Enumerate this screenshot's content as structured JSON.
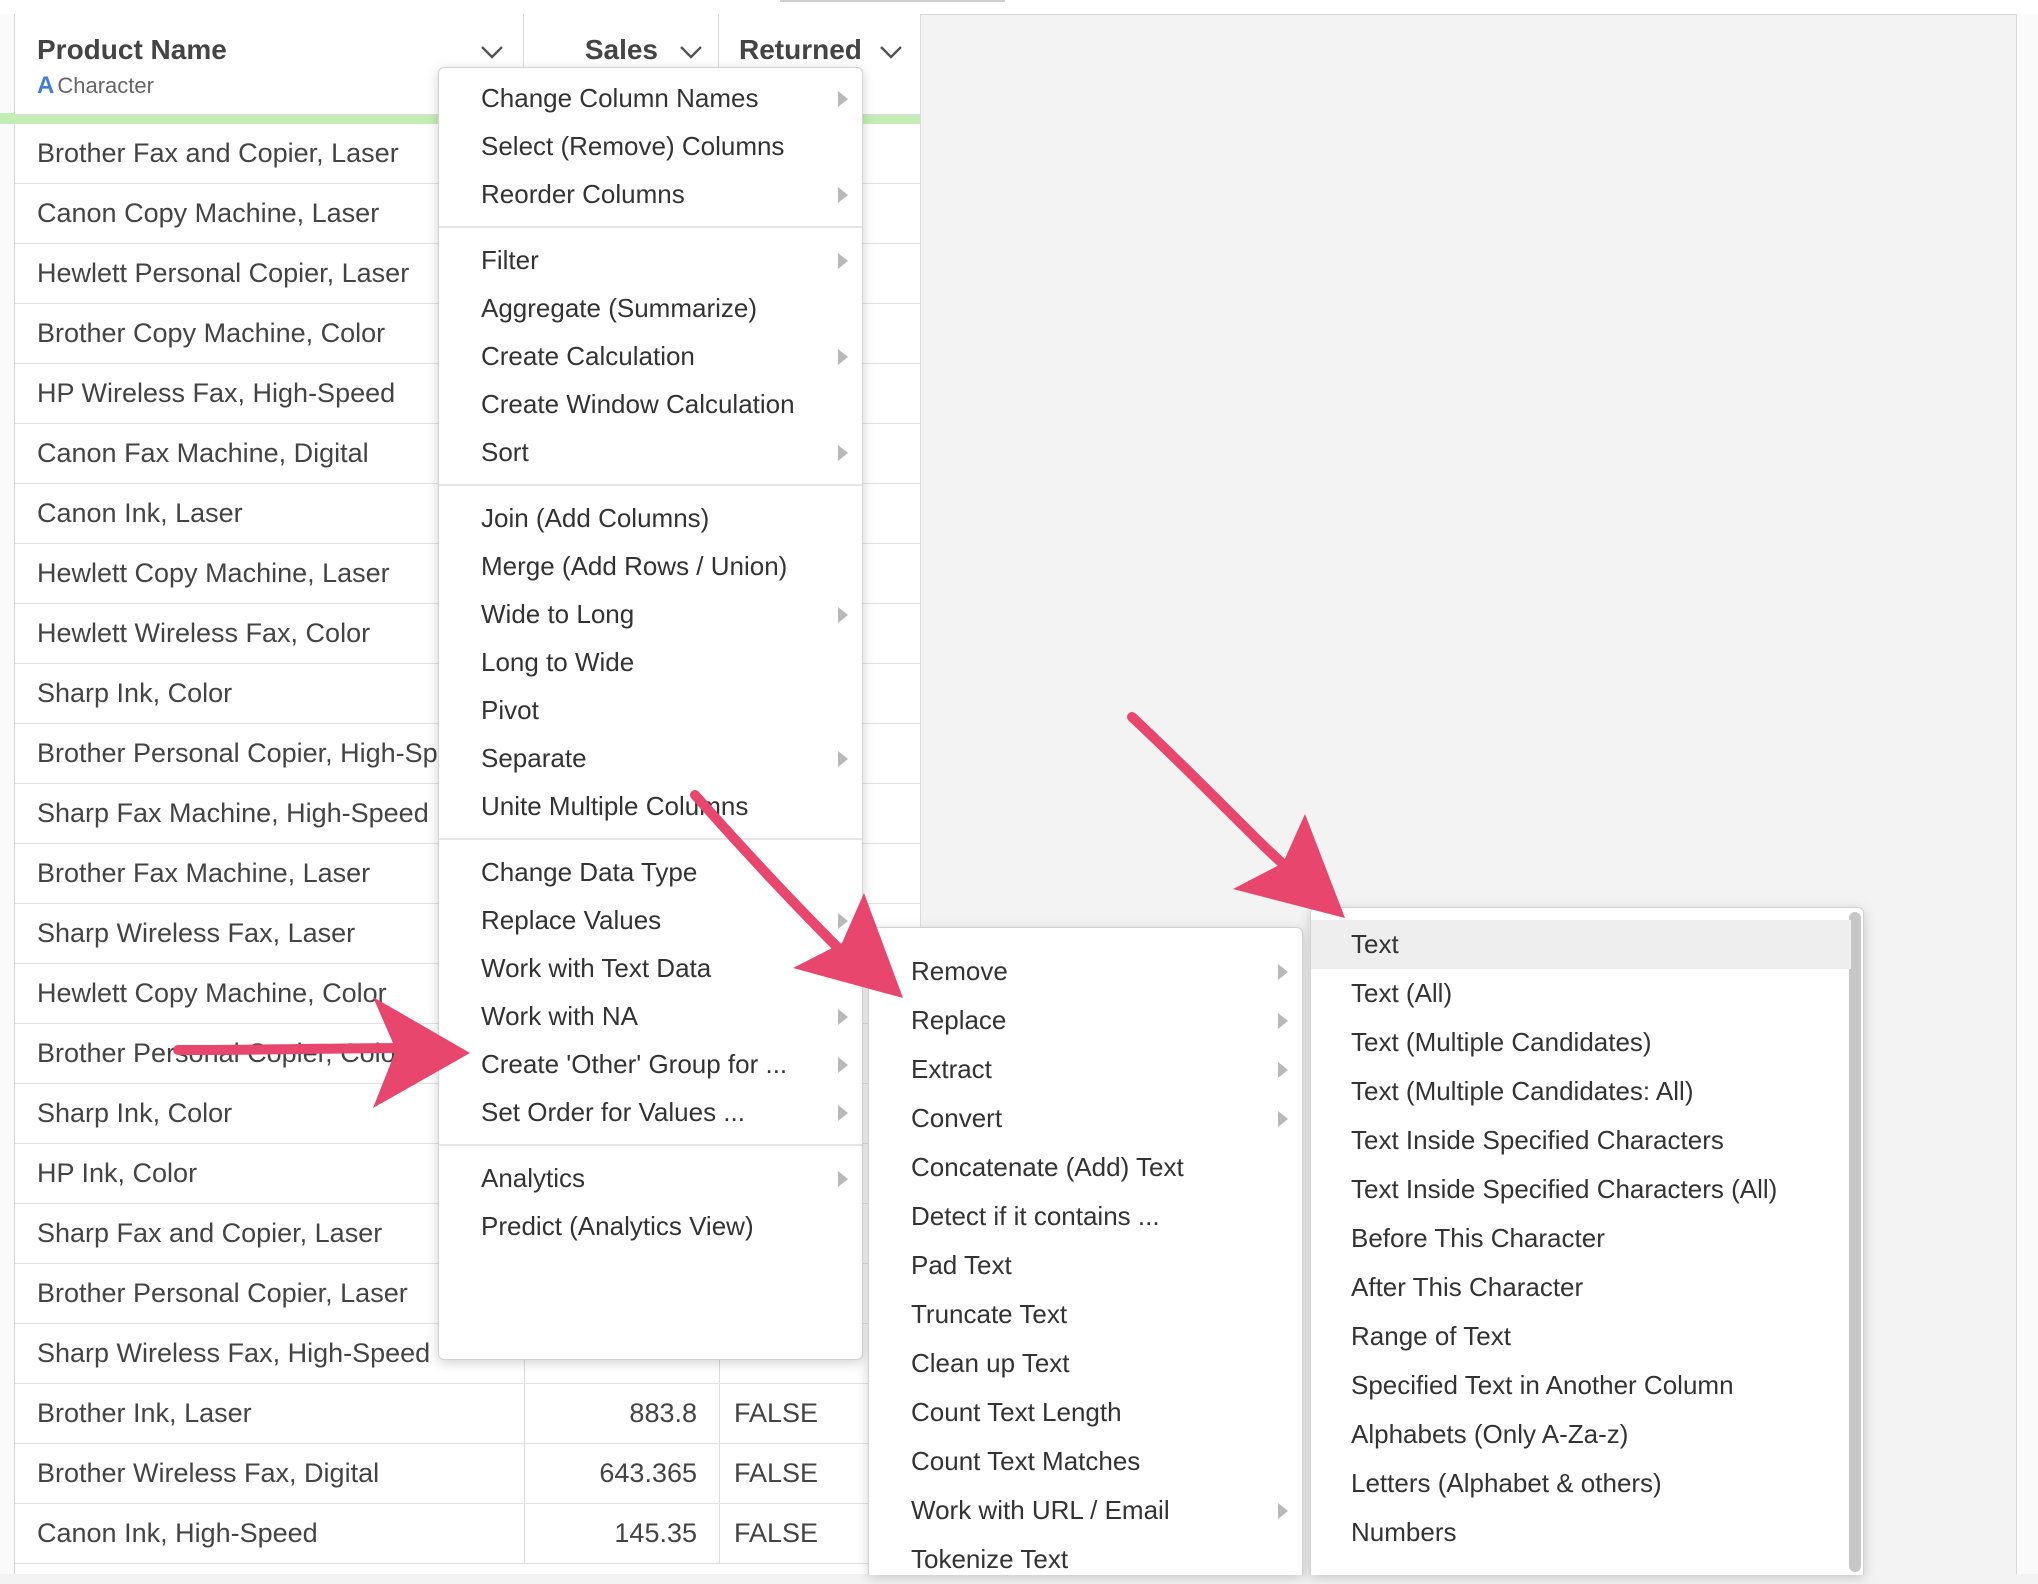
{
  "colors": {
    "accent_green": "#c2eeb6",
    "type_icon_blue": "#3d7fd9",
    "arrow": "#e8466c"
  },
  "table": {
    "columns": [
      {
        "name": "Product Name",
        "type_icon": "A",
        "type": "Character"
      },
      {
        "name": "Sales"
      },
      {
        "name": "Returned"
      }
    ],
    "rows": [
      [
        "Brother Fax and Copier, Laser",
        "",
        ""
      ],
      [
        "Canon Copy Machine, Laser",
        "",
        ""
      ],
      [
        "Hewlett Personal Copier, Laser",
        "",
        ""
      ],
      [
        "Brother Copy Machine, Color",
        "",
        ""
      ],
      [
        "HP Wireless Fax, High-Speed",
        "",
        ""
      ],
      [
        "Canon Fax Machine, Digital",
        "",
        ""
      ],
      [
        "Canon Ink, Laser",
        "",
        ""
      ],
      [
        "Hewlett Copy Machine, Laser",
        "",
        ""
      ],
      [
        "Hewlett Wireless Fax, Color",
        "",
        ""
      ],
      [
        "Sharp Ink, Color",
        "",
        ""
      ],
      [
        "Brother Personal Copier, High-Speed",
        "",
        ""
      ],
      [
        "Sharp Fax Machine, High-Speed",
        "",
        ""
      ],
      [
        "Brother Fax Machine, Laser",
        "",
        ""
      ],
      [
        "Sharp Wireless Fax, Laser",
        "",
        ""
      ],
      [
        "Hewlett Copy Machine, Color",
        "",
        ""
      ],
      [
        "Brother Personal Copier, Color",
        "",
        ""
      ],
      [
        "Sharp Ink, Color",
        "",
        ""
      ],
      [
        "HP Ink, Color",
        "",
        ""
      ],
      [
        "Sharp Fax and Copier, Laser",
        "",
        ""
      ],
      [
        "Brother Personal Copier, Laser",
        "",
        ""
      ],
      [
        "Sharp Wireless Fax, High-Speed",
        "",
        ""
      ],
      [
        "Brother Ink, Laser",
        "883.8",
        "FALSE"
      ],
      [
        "Brother Wireless Fax, Digital",
        "643.365",
        "FALSE"
      ],
      [
        "Canon Ink, High-Speed",
        "145.35",
        "FALSE"
      ]
    ]
  },
  "column_menu": {
    "groups": [
      [
        {
          "label": "Change Column Names",
          "submenu": true
        },
        {
          "label": "Select (Remove) Columns",
          "submenu": false
        },
        {
          "label": "Reorder Columns",
          "submenu": true
        }
      ],
      [
        {
          "label": "Filter",
          "submenu": true
        },
        {
          "label": "Aggregate (Summarize)",
          "submenu": false
        },
        {
          "label": "Create Calculation",
          "submenu": true
        },
        {
          "label": "Create Window Calculation",
          "submenu": false
        },
        {
          "label": "Sort",
          "submenu": true
        }
      ],
      [
        {
          "label": "Join (Add Columns)",
          "submenu": false
        },
        {
          "label": "Merge (Add Rows / Union)",
          "submenu": false
        },
        {
          "label": "Wide to Long",
          "submenu": true
        },
        {
          "label": "Long to Wide",
          "submenu": false
        },
        {
          "label": "Pivot",
          "submenu": false
        },
        {
          "label": "Separate",
          "submenu": true
        },
        {
          "label": "Unite Multiple Columns",
          "submenu": false
        }
      ],
      [
        {
          "label": "Change Data Type",
          "submenu": false
        },
        {
          "label": "Replace Values",
          "submenu": true
        },
        {
          "label": "Work with Text Data",
          "submenu": true
        },
        {
          "label": "Work with NA",
          "submenu": true
        },
        {
          "label": "Create 'Other' Group for ...",
          "submenu": true
        },
        {
          "label": "Set Order for Values ...",
          "submenu": true
        }
      ],
      [
        {
          "label": "Analytics",
          "submenu": true
        },
        {
          "label": "Predict (Analytics View)",
          "submenu": false
        }
      ]
    ]
  },
  "text_menu": {
    "items": [
      {
        "label": "Remove",
        "submenu": true
      },
      {
        "label": "Replace",
        "submenu": true
      },
      {
        "label": "Extract",
        "submenu": true
      },
      {
        "label": "Convert",
        "submenu": true
      },
      {
        "label": "Concatenate (Add) Text",
        "submenu": false
      },
      {
        "label": "Detect if it contains ...",
        "submenu": false
      },
      {
        "label": "Pad Text",
        "submenu": false
      },
      {
        "label": "Truncate Text",
        "submenu": false
      },
      {
        "label": "Clean up Text",
        "submenu": false
      },
      {
        "label": "Count Text Length",
        "submenu": false
      },
      {
        "label": "Count Text Matches",
        "submenu": false
      },
      {
        "label": "Work with URL / Email",
        "submenu": true
      },
      {
        "label": "Tokenize Text",
        "submenu": false
      }
    ]
  },
  "extract_menu": {
    "items": [
      {
        "label": "Text",
        "highlighted": true
      },
      {
        "label": "Text (All)"
      },
      {
        "label": "Text (Multiple Candidates)"
      },
      {
        "label": "Text (Multiple Candidates: All)"
      },
      {
        "label": "Text Inside Specified Characters"
      },
      {
        "label": "Text Inside Specified Characters (All)"
      },
      {
        "label": "Before This Character"
      },
      {
        "label": "After This Character"
      },
      {
        "label": "Range of Text"
      },
      {
        "label": "Specified Text in Another Column"
      },
      {
        "label": "Alphabets (Only A-Za-z)"
      },
      {
        "label": "Letters (Alphabet & others)"
      },
      {
        "label": "Numbers"
      }
    ]
  }
}
